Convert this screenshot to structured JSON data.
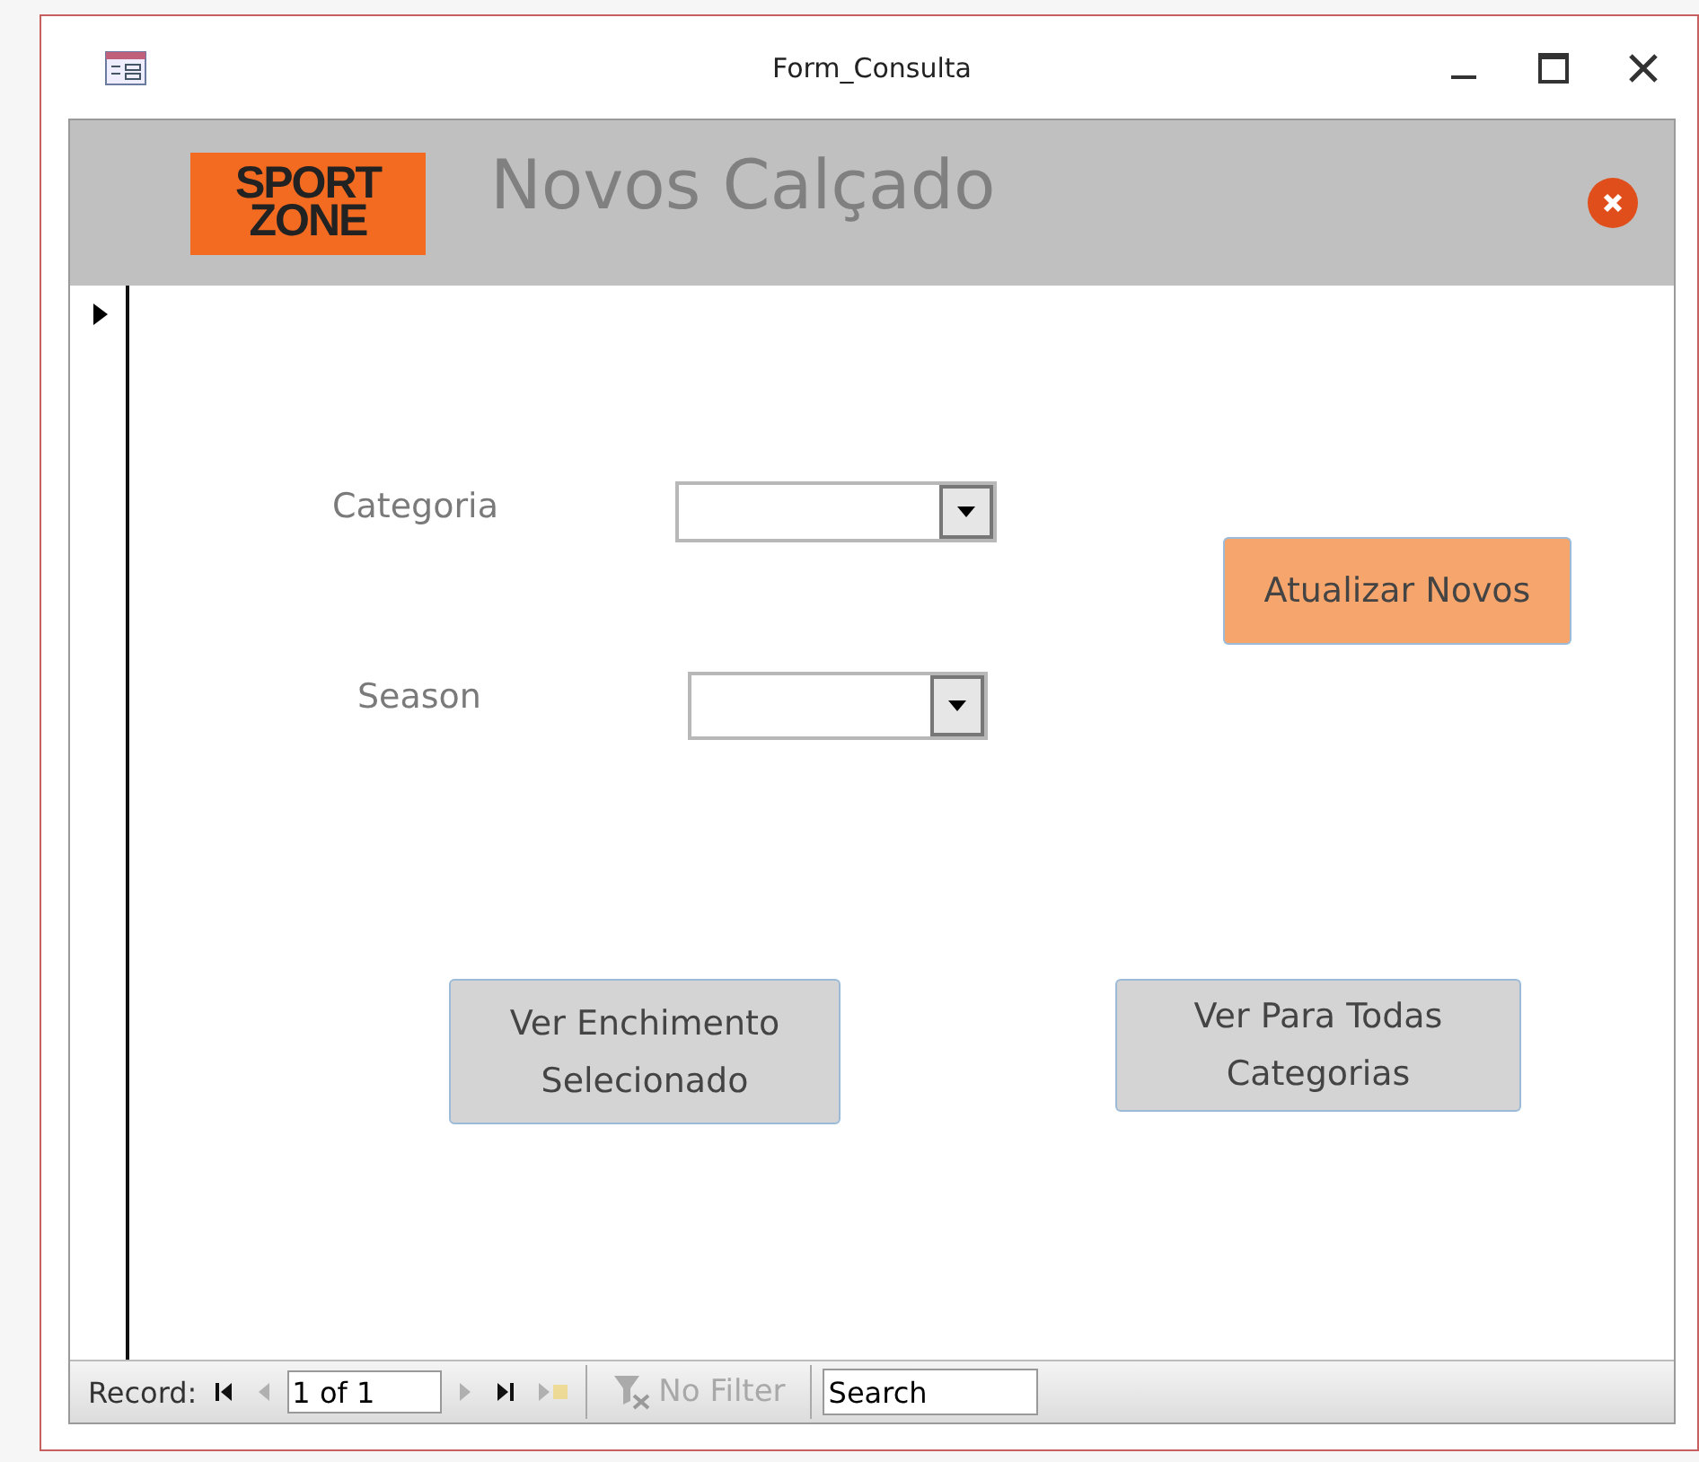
{
  "window": {
    "title": "Form_Consulta"
  },
  "header": {
    "logo_lines": [
      "SPORT",
      "ZONE"
    ],
    "title": "Novos Calçado"
  },
  "form": {
    "fields": [
      {
        "label": "Categoria"
      },
      {
        "label": "Season"
      }
    ],
    "buttons": [
      {
        "label": "Atualizar Novos",
        "kind": "primary"
      },
      {
        "label": "Ver Enchimento Selecionado",
        "kind": "secondary"
      },
      {
        "label": "Ver Para Todas Categorias",
        "kind": "secondary"
      }
    ]
  },
  "navigation": {
    "label": "Record:",
    "position": "1 of 1",
    "buttons": [
      {
        "kind": "first",
        "disabled": false
      },
      {
        "kind": "prev",
        "disabled": true
      },
      {
        "kind": "next",
        "disabled": true
      },
      {
        "kind": "last",
        "disabled": false
      },
      {
        "kind": "new",
        "disabled": true
      }
    ],
    "filter": {
      "label": "No Filter",
      "disabled": true
    },
    "search": {
      "value": "Search"
    }
  }
}
